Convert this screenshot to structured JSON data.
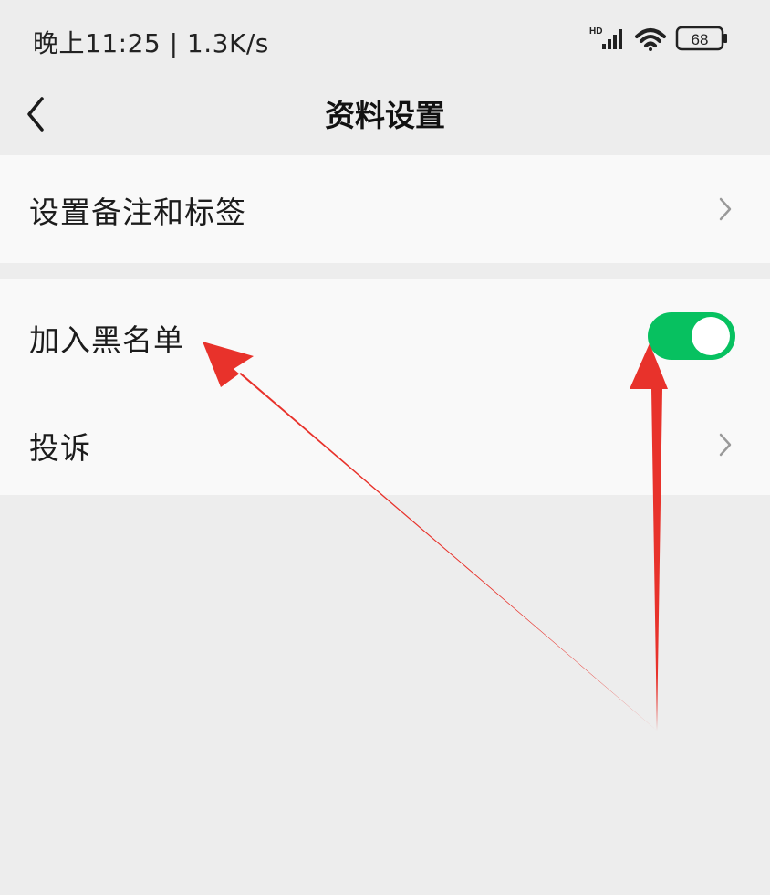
{
  "status_bar": {
    "text": "晚上11:25 | 1.3K/s",
    "network_badge": "HD",
    "battery_level": "68"
  },
  "header": {
    "title": "资料设置",
    "back_icon": "chevron-left-icon"
  },
  "settings": {
    "remark_label": "设置备注和标签",
    "blacklist_label": "加入黑名单",
    "blacklist_enabled": true,
    "complaint_label": "投诉"
  },
  "colors": {
    "toggle_on": "#07c160",
    "annotation_arrow": "#e8322b",
    "background": "#ededed",
    "row_background": "#f9f9f9"
  }
}
